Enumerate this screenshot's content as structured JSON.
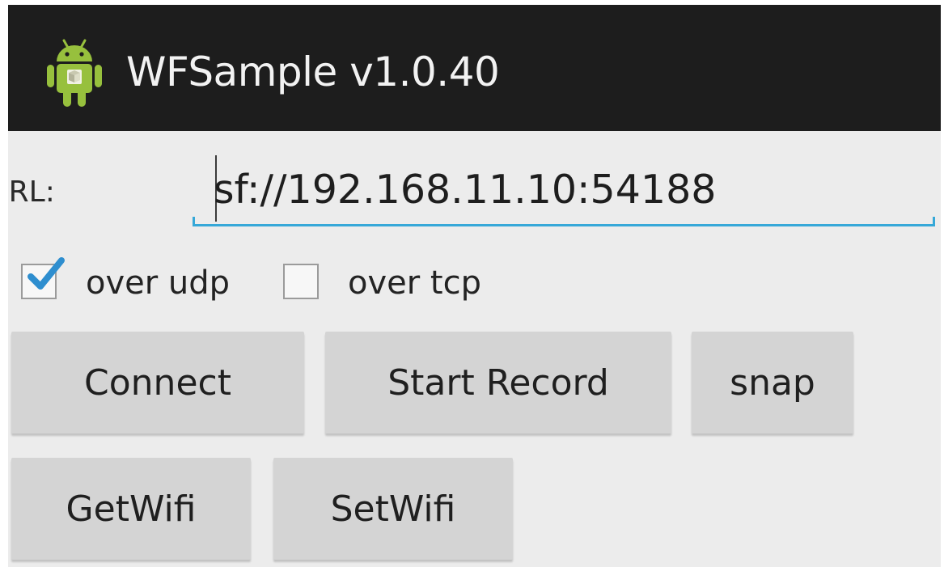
{
  "app": {
    "title": "WFSample v1.0.40",
    "icon": "android-robot-icon"
  },
  "url": {
    "label": "JRL:",
    "value": "sf://192.168.11.10:54188"
  },
  "checkboxes": [
    {
      "label": "over udp",
      "checked": true
    },
    {
      "label": "over tcp",
      "checked": false
    }
  ],
  "buttons": {
    "connect": "Connect",
    "start_record": "Start Record",
    "snap": "snap",
    "get_wifi": "GetWifi",
    "set_wifi": "SetWifi"
  },
  "colors": {
    "action_bar": "#1d1d1d",
    "background": "#ececec",
    "accent": "#36a8d8",
    "button": "#d4d4d4",
    "android_green": "#97c03d"
  }
}
